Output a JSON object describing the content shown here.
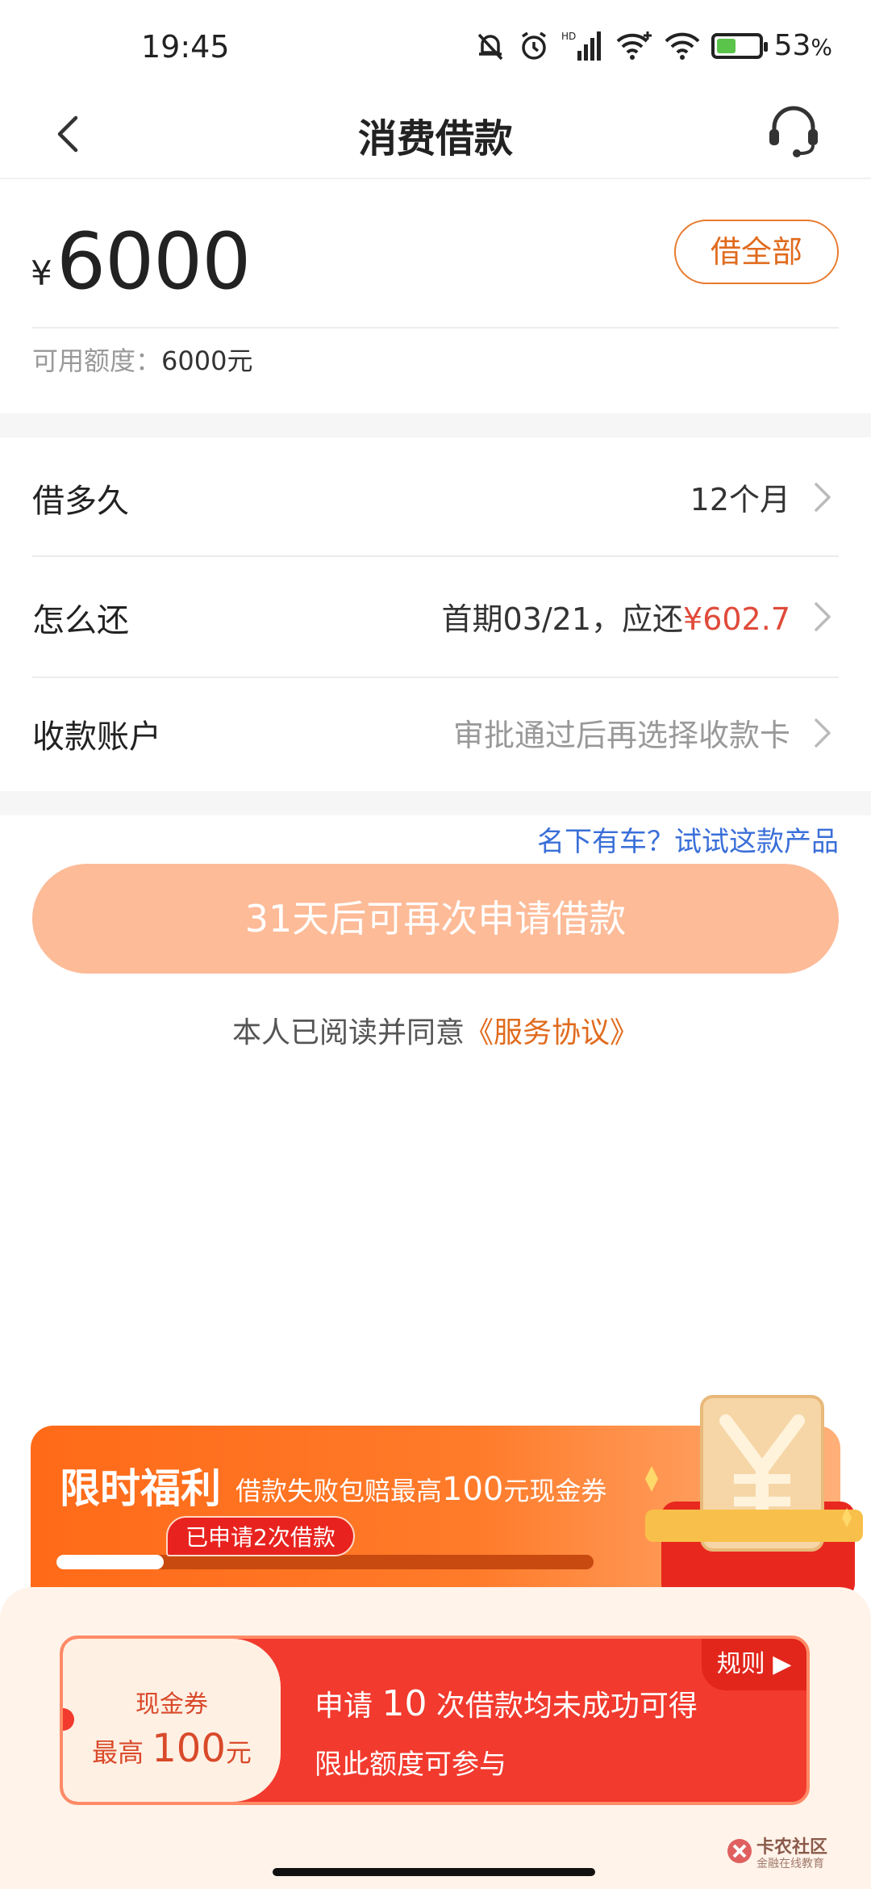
{
  "status_bar": {
    "time": "19:45",
    "battery": "53",
    "battery_unit": "%",
    "battery_level": 0.53,
    "network_label": "HD"
  },
  "nav": {
    "title": "消费借款"
  },
  "amount_card": {
    "currency": "¥",
    "amount": "6000",
    "borrow_all_label": "借全部",
    "credit_label": "可用额度：",
    "credit_value": "6000元"
  },
  "options": {
    "term": {
      "label": "借多久",
      "value": "12个月"
    },
    "repay": {
      "label": "怎么还",
      "value_prefix": "首期03/21，应还",
      "value_amount": "¥602.7"
    },
    "account": {
      "label": "收款账户",
      "value": "审批通过后再选择收款卡"
    }
  },
  "car_link": "名下有车？试试这款产品",
  "apply_button": "31天后可再次申请借款",
  "agreement": {
    "text": "本人已阅读并同意",
    "link": "《服务协议》"
  },
  "promo": {
    "title": "限时福利",
    "subtitle_prefix": "借款失败包赔最高",
    "subtitle_amount": "100",
    "subtitle_suffix": "元现金券",
    "badge": "已申请2次借款",
    "progress": 0.2
  },
  "coupon": {
    "type": "现金券",
    "amount_prefix": "最高",
    "amount_value": "100",
    "amount_suffix": "元",
    "line1_prefix": "申请",
    "line1_count": "10",
    "line1_suffix": "次借款均未成功可得",
    "line2": "限此额度可参与",
    "rules_label": "规则 ▶"
  },
  "watermark": {
    "title": "卡农社区",
    "subtitle": "金融在线教育"
  },
  "colors": {
    "accent": "#e06b1e",
    "button": "#fdbb98",
    "red": "#e04a3a",
    "link": "#3a6fd8"
  }
}
